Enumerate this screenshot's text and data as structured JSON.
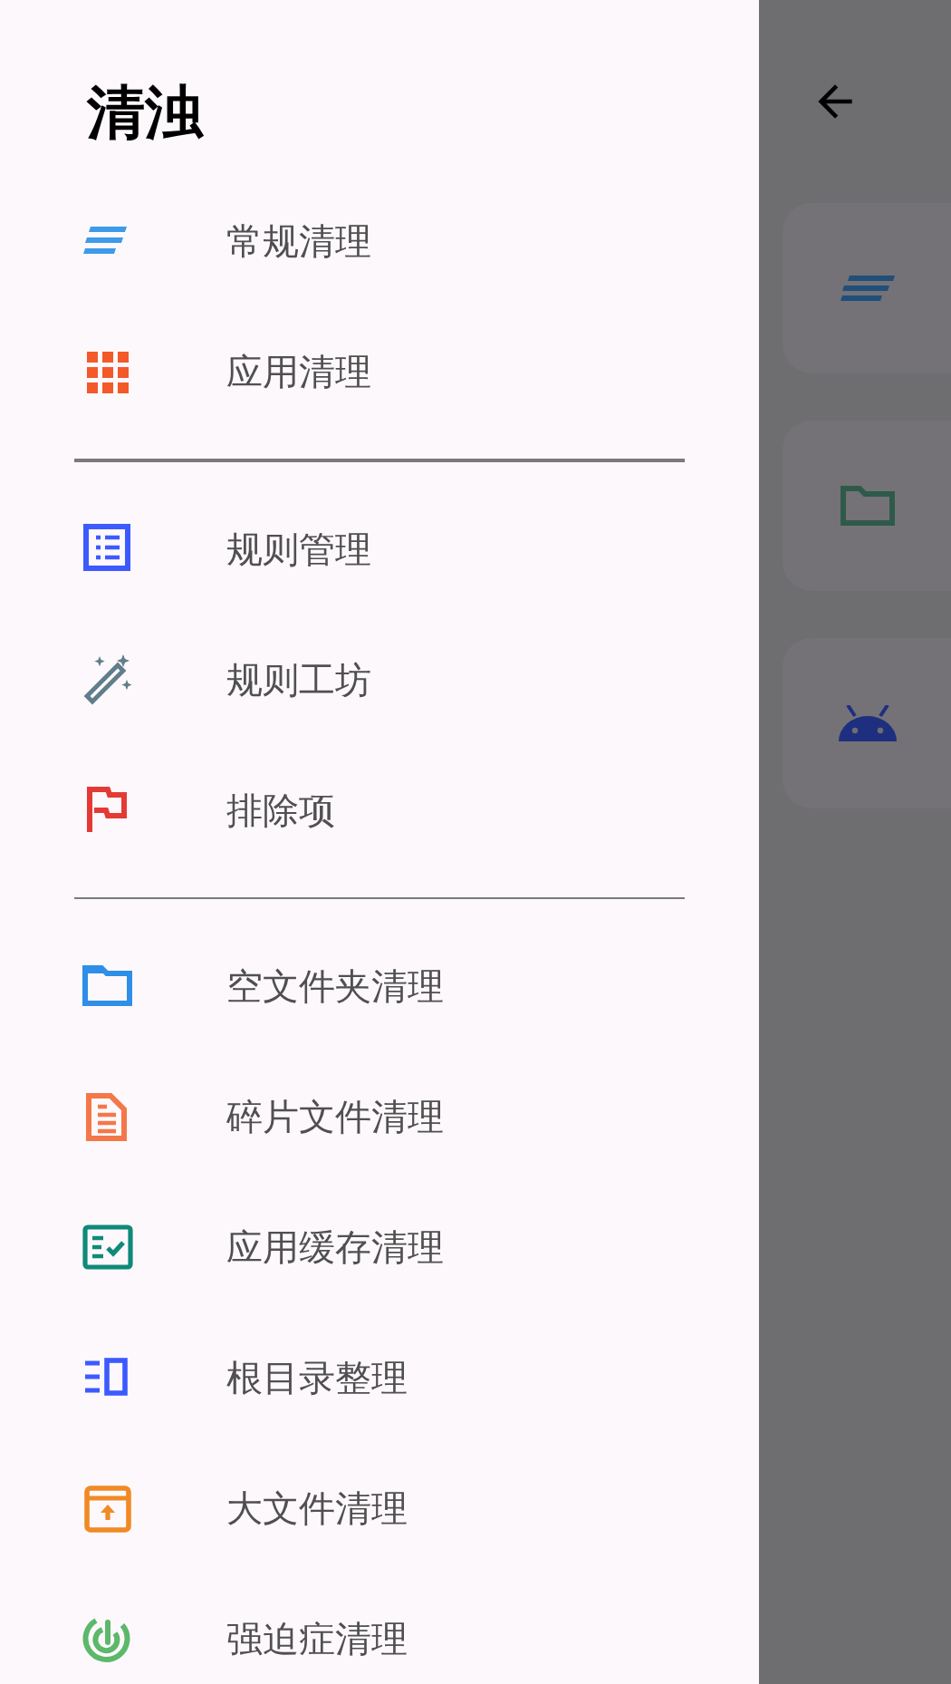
{
  "drawer": {
    "title": "清浊",
    "sections": [
      [
        {
          "label": "常规清理",
          "kind": "lines",
          "color": "#3d9be9"
        },
        {
          "label": "应用清理",
          "kind": "grid",
          "color": "#f4592a"
        }
      ],
      [
        {
          "label": "规则管理",
          "kind": "list",
          "color": "#3d5afe"
        },
        {
          "label": "规则工坊",
          "kind": "wand",
          "color": "#607d8b"
        },
        {
          "label": "排除项",
          "kind": "flag",
          "color": "#e53935"
        }
      ],
      [
        {
          "label": "空文件夹清理",
          "kind": "folder",
          "color": "#2f8ee8"
        },
        {
          "label": "碎片文件清理",
          "kind": "doc",
          "color": "#f4774a"
        },
        {
          "label": "应用缓存清理",
          "kind": "check",
          "color": "#0f8a78"
        },
        {
          "label": "根目录整理",
          "kind": "columns",
          "color": "#3d5afe"
        },
        {
          "label": "大文件清理",
          "kind": "box",
          "color": "#f08a24"
        },
        {
          "label": "强迫症清理",
          "kind": "target",
          "color": "#5cb86a"
        }
      ]
    ]
  }
}
